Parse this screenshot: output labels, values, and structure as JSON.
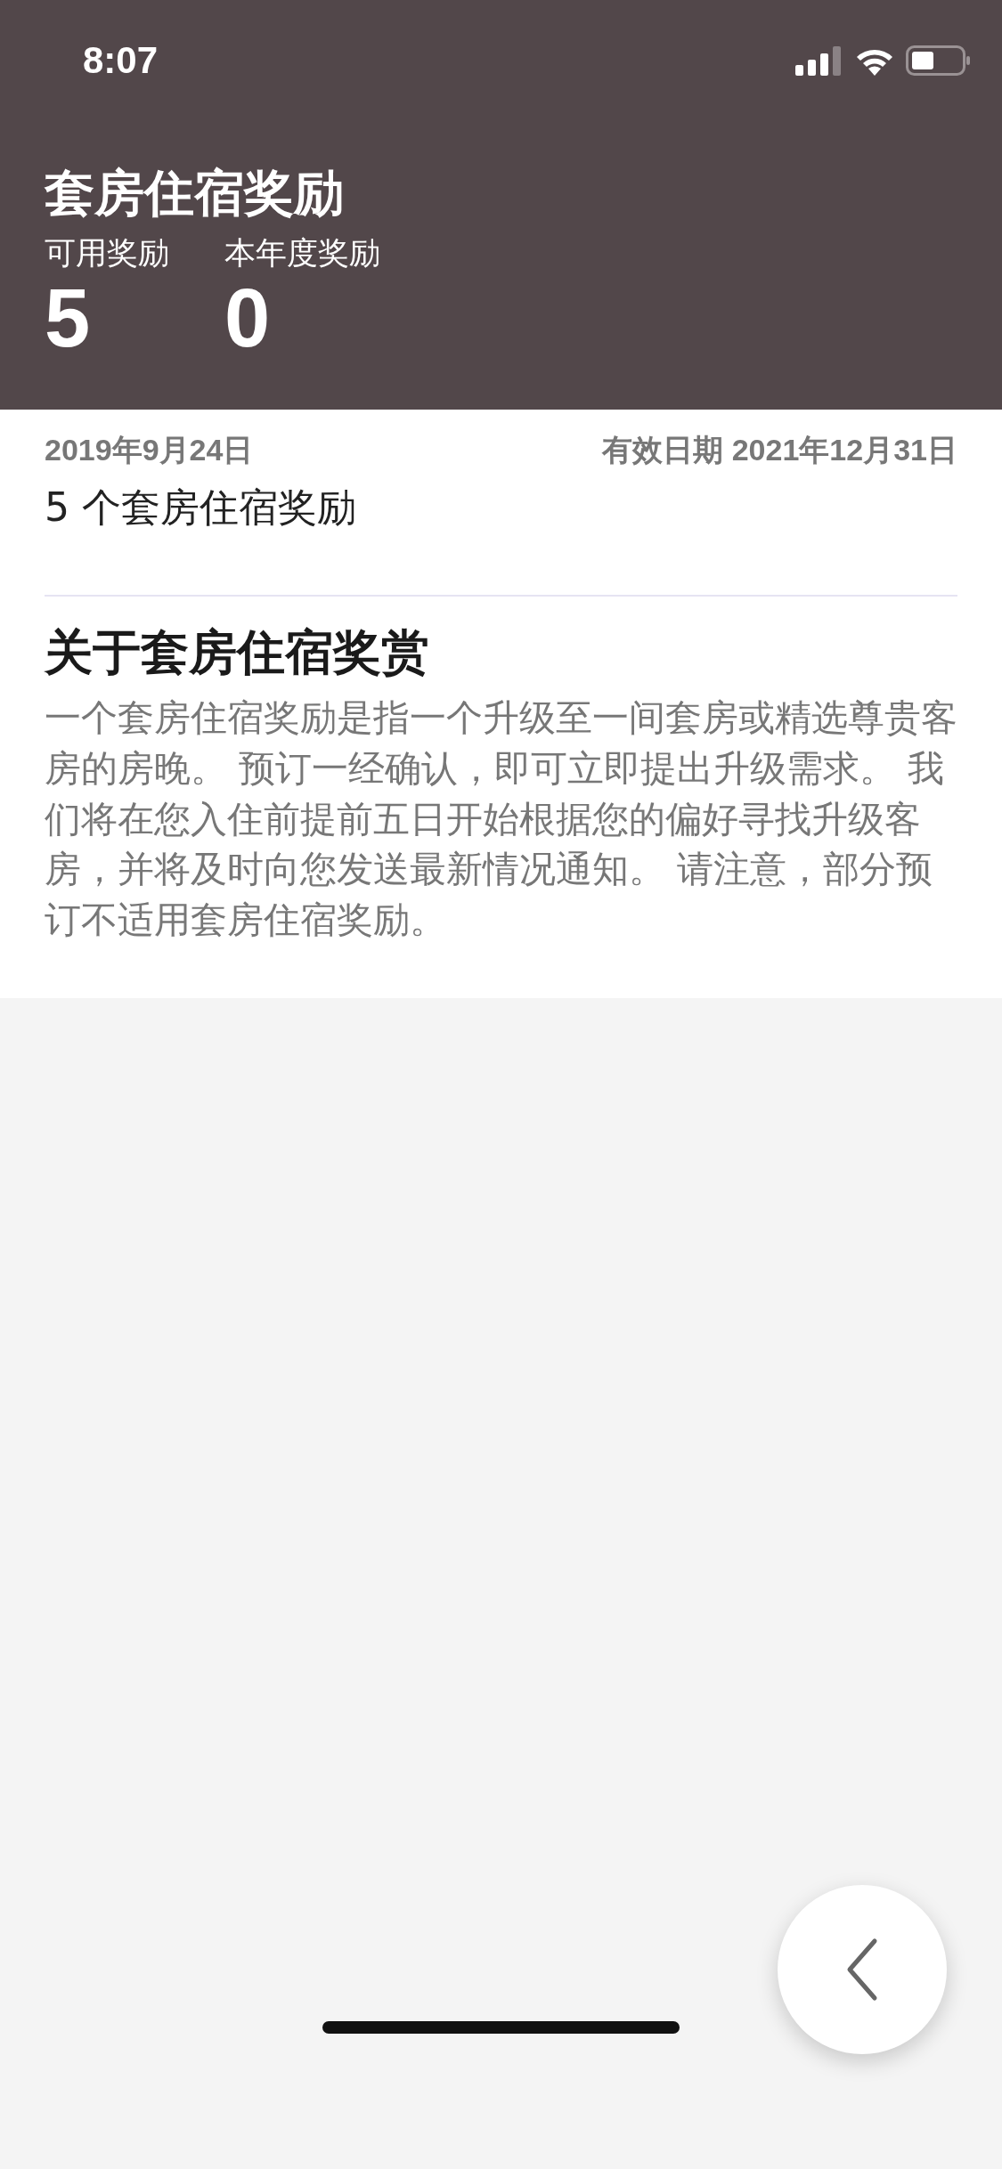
{
  "status_bar": {
    "time": "8:07"
  },
  "header": {
    "title": "套房住宿奖励",
    "stats": [
      {
        "label": "可用奖励",
        "value": "5"
      },
      {
        "label": "本年度奖励",
        "value": "0"
      }
    ]
  },
  "award": {
    "date": "2019年9月24日",
    "expiry": "有效日期 2021年12月31日",
    "description": "5 个套房住宿奖励"
  },
  "about": {
    "heading": "关于套房住宿奖赏",
    "body": "一个套房住宿奖励是指一个升级至一间套房或精选尊贵客房的房晚。 预订一经确认，即可立即提出升级需求。 我们将在您入住前提前五日开始根据您的偏好寻找升级客房，并将及时向您发送最新情况通知。 请注意，部分预订不适用套房住宿奖励。"
  }
}
